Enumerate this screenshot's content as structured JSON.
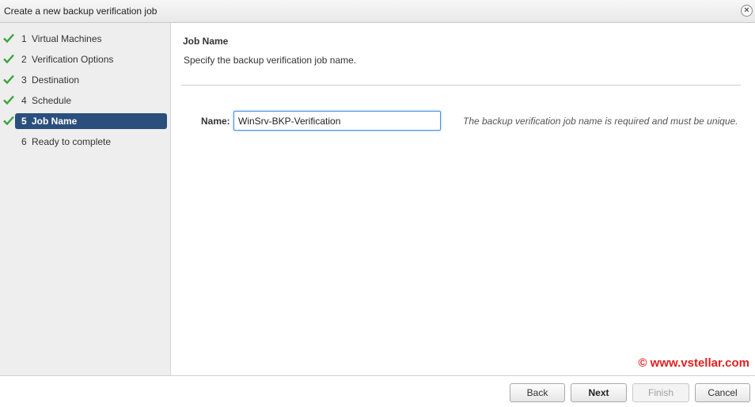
{
  "window": {
    "title": "Create a new backup verification job",
    "close_icon": "close-icon"
  },
  "steps": [
    {
      "num": "1",
      "label": "Virtual Machines",
      "status": "done"
    },
    {
      "num": "2",
      "label": "Verification Options",
      "status": "done"
    },
    {
      "num": "3",
      "label": "Destination",
      "status": "done"
    },
    {
      "num": "4",
      "label": "Schedule",
      "status": "done"
    },
    {
      "num": "5",
      "label": "Job Name",
      "status": "active"
    },
    {
      "num": "6",
      "label": "Ready to complete",
      "status": "pending"
    }
  ],
  "content": {
    "title": "Job Name",
    "description": "Specify the backup verification job name.",
    "name_label": "Name:",
    "name_value": "WinSrv-BKP-Verification",
    "hint": "The backup verification job name is required and must be unique."
  },
  "watermark": "© www.vstellar.com",
  "footer": {
    "back": "Back",
    "next": "Next",
    "finish": "Finish",
    "cancel": "Cancel"
  },
  "colors": {
    "active_step": "#2b4f7d",
    "check": "#3aa53a",
    "watermark": "#e02020"
  }
}
